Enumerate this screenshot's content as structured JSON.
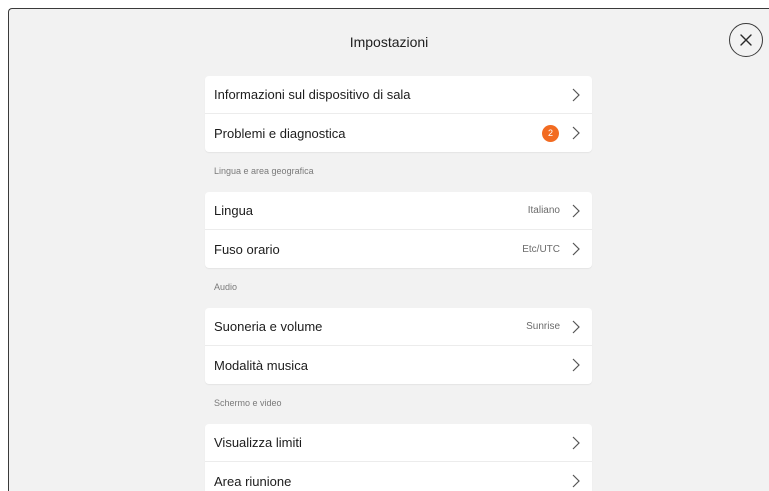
{
  "header": {
    "title": "Impostazioni",
    "close_icon": "close-icon"
  },
  "sections": [
    {
      "label": "",
      "rows": [
        {
          "label": "Informazioni sul dispositivo di sala",
          "value": "",
          "badge": ""
        },
        {
          "label": "Problemi e diagnostica",
          "value": "",
          "badge": "2"
        }
      ]
    },
    {
      "label": "Lingua e area geografica",
      "rows": [
        {
          "label": "Lingua",
          "value": "Italiano",
          "badge": ""
        },
        {
          "label": "Fuso orario",
          "value": "Etc/UTC",
          "badge": ""
        }
      ]
    },
    {
      "label": "Audio",
      "rows": [
        {
          "label": "Suoneria e volume",
          "value": "Sunrise",
          "badge": ""
        },
        {
          "label": "Modalità musica",
          "value": "",
          "badge": ""
        }
      ]
    },
    {
      "label": "Schermo e video",
      "rows": [
        {
          "label": "Visualizza limiti",
          "value": "",
          "badge": ""
        },
        {
          "label": "Area riunione",
          "value": "",
          "badge": ""
        }
      ]
    }
  ],
  "colors": {
    "badge": "#f26b21",
    "background": "#f2f2f2",
    "card": "#ffffff"
  }
}
